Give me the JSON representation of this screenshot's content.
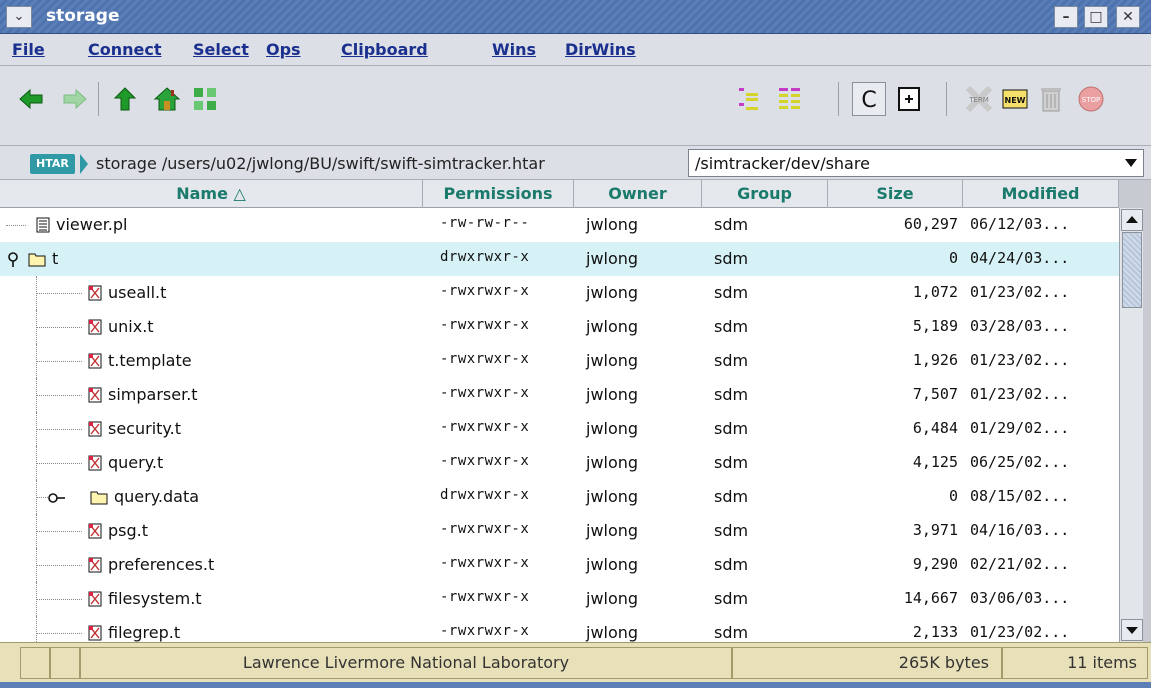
{
  "window": {
    "title": "storage"
  },
  "menu": [
    "File",
    "Connect",
    "Select",
    "Ops",
    "Clipboard",
    "Wins",
    "DirWins"
  ],
  "toolbar": {
    "left": [
      "back-arrow-icon",
      "forward-arrow-icon",
      "up-arrow-icon",
      "home-icon",
      "refresh-icon"
    ],
    "right": [
      "tree-view-icon",
      "list-view-icon",
      "copy-c-icon",
      "new-window-icon",
      "terminal-icon",
      "new-icon",
      "trash-icon",
      "stop-icon"
    ],
    "terminal_label": "TERM",
    "new_label": "NEW",
    "stop_label": "STOP"
  },
  "pathbar": {
    "badge": "HTAR",
    "path": "storage  /users/u02/jwlong/BU/swift/swift-simtracker.htar",
    "dir_select": "/simtracker/dev/share"
  },
  "columns": [
    "Name △",
    "Permissions",
    "Owner",
    "Group",
    "Size",
    "Modified"
  ],
  "rows": [
    {
      "name": "viewer.pl",
      "perm": "-rw-rw-r--",
      "owner": "jwlong",
      "group": "sdm",
      "size": "60,297",
      "mod": "06/12/03...",
      "type": "file",
      "depth": 0
    },
    {
      "name": "t",
      "perm": "drwxrwxr-x",
      "owner": "jwlong",
      "group": "sdm",
      "size": "0",
      "mod": "04/24/03...",
      "type": "folder-open",
      "depth": 0,
      "selected": true
    },
    {
      "name": "useall.t",
      "perm": "-rwxrwxr-x",
      "owner": "jwlong",
      "group": "sdm",
      "size": "1,072",
      "mod": "01/23/02...",
      "type": "file",
      "depth": 1
    },
    {
      "name": "unix.t",
      "perm": "-rwxrwxr-x",
      "owner": "jwlong",
      "group": "sdm",
      "size": "5,189",
      "mod": "03/28/03...",
      "type": "file",
      "depth": 1
    },
    {
      "name": "t.template",
      "perm": "-rwxrwxr-x",
      "owner": "jwlong",
      "group": "sdm",
      "size": "1,926",
      "mod": "01/23/02...",
      "type": "file",
      "depth": 1
    },
    {
      "name": "simparser.t",
      "perm": "-rwxrwxr-x",
      "owner": "jwlong",
      "group": "sdm",
      "size": "7,507",
      "mod": "01/23/02...",
      "type": "file",
      "depth": 1
    },
    {
      "name": "security.t",
      "perm": "-rwxrwxr-x",
      "owner": "jwlong",
      "group": "sdm",
      "size": "6,484",
      "mod": "01/29/02...",
      "type": "file",
      "depth": 1
    },
    {
      "name": "query.t",
      "perm": "-rwxrwxr-x",
      "owner": "jwlong",
      "group": "sdm",
      "size": "4,125",
      "mod": "06/25/02...",
      "type": "file",
      "depth": 1
    },
    {
      "name": "query.data",
      "perm": "drwxrwxr-x",
      "owner": "jwlong",
      "group": "sdm",
      "size": "0",
      "mod": "08/15/02...",
      "type": "folder",
      "depth": 1
    },
    {
      "name": "psg.t",
      "perm": "-rwxrwxr-x",
      "owner": "jwlong",
      "group": "sdm",
      "size": "3,971",
      "mod": "04/16/03...",
      "type": "file",
      "depth": 1
    },
    {
      "name": "preferences.t",
      "perm": "-rwxrwxr-x",
      "owner": "jwlong",
      "group": "sdm",
      "size": "9,290",
      "mod": "02/21/02...",
      "type": "file",
      "depth": 1
    },
    {
      "name": "filesystem.t",
      "perm": "-rwxrwxr-x",
      "owner": "jwlong",
      "group": "sdm",
      "size": "14,667",
      "mod": "03/06/03...",
      "type": "file",
      "depth": 1
    },
    {
      "name": "filegrep.t",
      "perm": "-rwxrwxr-x",
      "owner": "jwlong",
      "group": "sdm",
      "size": "2,133",
      "mod": "01/23/02...",
      "type": "file",
      "depth": 1
    }
  ],
  "status": {
    "org": "Lawrence Livermore National Laboratory",
    "bytes": "265K bytes",
    "items": "11 items"
  }
}
